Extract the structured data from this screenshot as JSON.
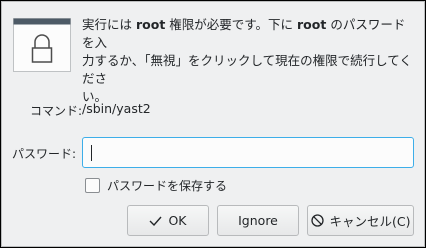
{
  "message": {
    "part1": "実行には ",
    "root1": "root",
    "part2": " 権限が必要です。下に ",
    "root2": "root",
    "part3": " のパスワードを入\n力するか、「無視」をクリックして現在の権限で続行してくださ\nい。"
  },
  "command": {
    "label": "コマンド:",
    "value": "/sbin/yast2"
  },
  "password": {
    "label": "パスワード:",
    "value": ""
  },
  "save_password": {
    "label": "パスワードを保存する",
    "checked": false
  },
  "buttons": {
    "ok_label": "OK",
    "ignore_label": "Ignore",
    "cancel_label": "キャンセル(C)"
  },
  "colors": {
    "focus": "#3daee9",
    "background": "#eff0f1"
  }
}
